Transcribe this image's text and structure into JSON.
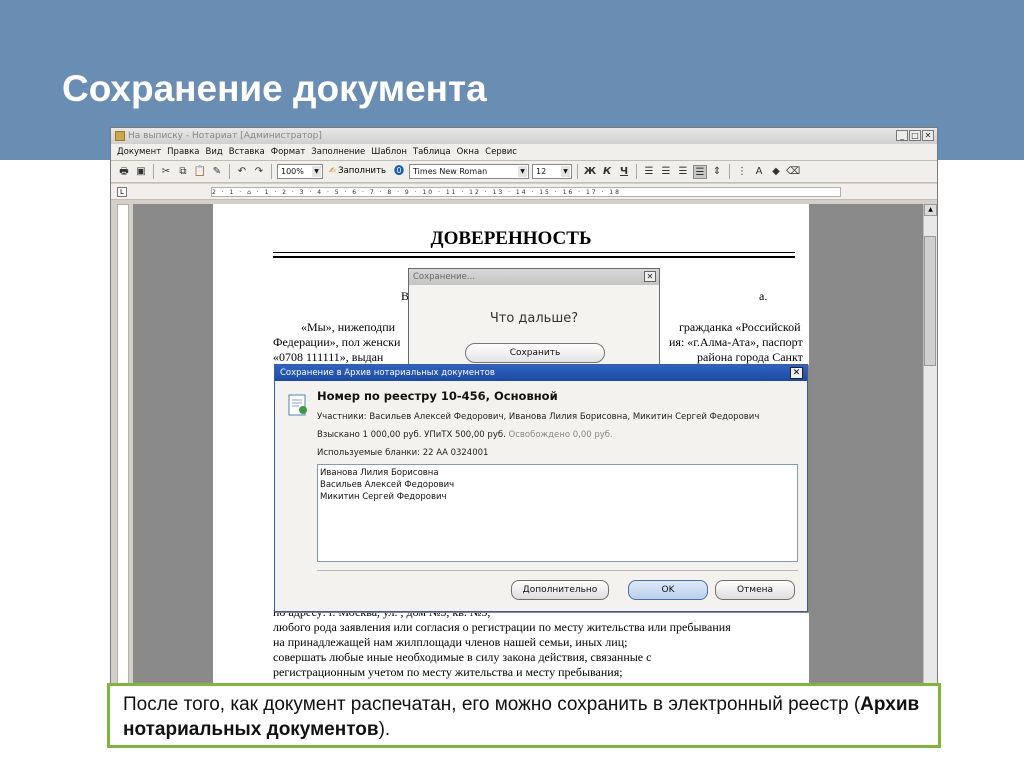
{
  "slide": {
    "title": "Сохранение документа",
    "caption_part1": "После того, как документ распечатан, его можно сохранить в электронный реестр (",
    "caption_bold": "Архив нотариальных документов",
    "caption_part2": ")."
  },
  "app": {
    "window_title": "На выписку - Нотариат [Администратор]",
    "menu": [
      "Документ",
      "Правка",
      "Вид",
      "Вставка",
      "Формат",
      "Заполнение",
      "Шаблон",
      "Таблица",
      "Окна",
      "Сервис"
    ],
    "toolbar": {
      "zoom": "100%",
      "fill_label": "Заполнить",
      "font": "Times New Roman",
      "size": "12",
      "bold": "Ж",
      "italic": "К",
      "underline": "Ч"
    },
    "ruler_text": "2 · 1 · ⌂ · 1 · 2 · 3 · 4 · 5 · 6 · 7 · 8 · 9 · 10 · 11 · 12 · 13 · 14 · 15 · 16 · 17 · 18"
  },
  "document": {
    "title": "ДОВЕРЕННОСТЬ",
    "frag_city": "В",
    "frag_dot": "а.",
    "line1_left": "«Мы»,   нижеподпи",
    "line1_right": "гражданка  «Российской",
    "line2_left": "Федерации», пол женски",
    "line2_right": "ия: «г.Алма-Ата», паспорт",
    "line3_left": "«0708   111111»,   выдан",
    "line3_right": "района  города  Санкт",
    "lines_bottom": [
      "по адресу: г. Москва, ул. , дом №5, кв. №5,",
      "         любого рода заявления или согласия о регистрации по месту жительства или пребывания",
      "на принадлежащей нам жилплощади членов нашей семьи, иных лиц;",
      "         совершать  любые  иные  необходимые  в  силу  закона  действия,  связанные  с",
      "регистрационным учетом по месту жительства и месту пребывания;"
    ]
  },
  "dialog_small": {
    "title": "Сохранение...",
    "question": "Что дальше?",
    "save_button": "Сохранить"
  },
  "dialog_archive": {
    "title": "Сохранение в Архив нотариальных документов",
    "registry": "Номер по реестру 10-456, Основной",
    "participants": "Участники: Васильев Алексей Федорович, Иванова Лилия Борисовна, Микитин Сергей Федорович",
    "collected": "Взыскано 1 000,00 руб. УПиТХ 500,00 руб.",
    "exempt": "Освобождено 0,00 руб.",
    "forms": "Используемые бланки: 22 АА 0324001",
    "list": [
      "Иванова Лилия Борисовна",
      "Васильев Алексей Федорович",
      "Микитин Сергей Федорович"
    ],
    "btn_more": "Дополнительно",
    "btn_ok": "OK",
    "btn_cancel": "Отмена"
  }
}
